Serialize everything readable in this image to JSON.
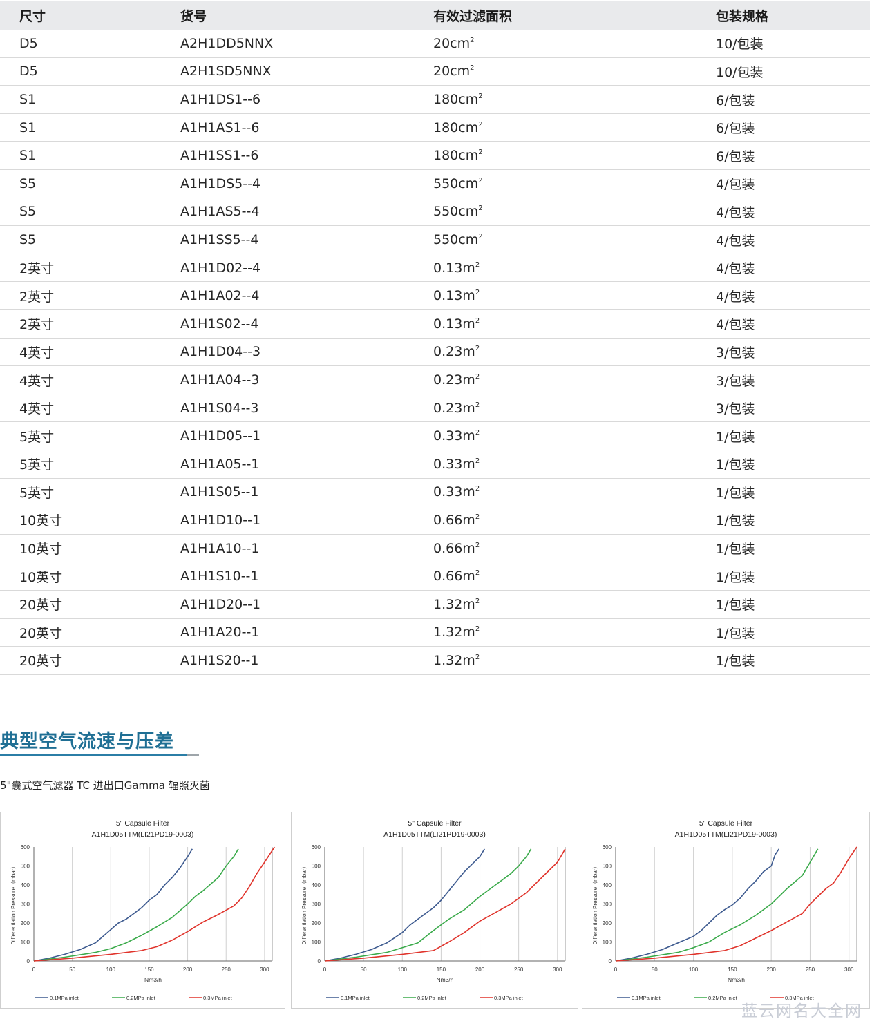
{
  "table": {
    "headers": [
      "尺寸",
      "货号",
      "有效过滤面积",
      "包装规格"
    ],
    "rows": [
      {
        "size": "D5",
        "part": "A2H1DD5NNX",
        "area": "20cm",
        "area_sup": "2",
        "pack": "10/包装"
      },
      {
        "size": "D5",
        "part": "A2H1SD5NNX",
        "area": "20cm",
        "area_sup": "2",
        "pack": "10/包装"
      },
      {
        "size": "S1",
        "part": "A1H1DS1--6",
        "area": "180cm",
        "area_sup": "2",
        "pack": "6/包装"
      },
      {
        "size": "S1",
        "part": "A1H1AS1--6",
        "area": "180cm",
        "area_sup": "2",
        "pack": "6/包装"
      },
      {
        "size": "S1",
        "part": "A1H1SS1--6",
        "area": "180cm",
        "area_sup": "2",
        "pack": "6/包装"
      },
      {
        "size": "S5",
        "part": "A1H1DS5--4",
        "area": "550cm",
        "area_sup": "2",
        "pack": "4/包装"
      },
      {
        "size": "S5",
        "part": "A1H1AS5--4",
        "area": "550cm",
        "area_sup": "2",
        "pack": "4/包装"
      },
      {
        "size": "S5",
        "part": "A1H1SS5--4",
        "area": "550cm",
        "area_sup": "2",
        "pack": "4/包装"
      },
      {
        "size": "2英寸",
        "part": "A1H1D02--4",
        "area": "0.13m",
        "area_sup": "2",
        "pack": "4/包装"
      },
      {
        "size": "2英寸",
        "part": "A1H1A02--4",
        "area": "0.13m",
        "area_sup": "2",
        "pack": "4/包装"
      },
      {
        "size": "2英寸",
        "part": "A1H1S02--4",
        "area": "0.13m",
        "area_sup": "2",
        "pack": "4/包装"
      },
      {
        "size": "4英寸",
        "part": "A1H1D04--3",
        "area": "0.23m",
        "area_sup": "2",
        "pack": "3/包装"
      },
      {
        "size": "4英寸",
        "part": "A1H1A04--3",
        "area": "0.23m",
        "area_sup": "2",
        "pack": "3/包装"
      },
      {
        "size": "4英寸",
        "part": "A1H1S04--3",
        "area": "0.23m",
        "area_sup": "2",
        "pack": "3/包装"
      },
      {
        "size": "5英寸",
        "part": "A1H1D05--1",
        "area": "0.33m",
        "area_sup": "2",
        "pack": "1/包装"
      },
      {
        "size": "5英寸",
        "part": "A1H1A05--1",
        "area": "0.33m",
        "area_sup": "2",
        "pack": "1/包装"
      },
      {
        "size": "5英寸",
        "part": "A1H1S05--1",
        "area": "0.33m",
        "area_sup": "2",
        "pack": "1/包装"
      },
      {
        "size": "10英寸",
        "part": "A1H1D10--1",
        "area": "0.66m",
        "area_sup": "2",
        "pack": "1/包装"
      },
      {
        "size": "10英寸",
        "part": "A1H1A10--1",
        "area": "0.66m",
        "area_sup": "2",
        "pack": "1/包装"
      },
      {
        "size": "10英寸",
        "part": "A1H1S10--1",
        "area": "0.66m",
        "area_sup": "2",
        "pack": "1/包装"
      },
      {
        "size": "20英寸",
        "part": "A1H1D20--1",
        "area": "1.32m",
        "area_sup": "2",
        "pack": "1/包装"
      },
      {
        "size": "20英寸",
        "part": "A1H1A20--1",
        "area": "1.32m",
        "area_sup": "2",
        "pack": "1/包装"
      },
      {
        "size": "20英寸",
        "part": "A1H1S20--1",
        "area": "1.32m",
        "area_sup": "2",
        "pack": "1/包装"
      }
    ]
  },
  "section": {
    "title": "典型空气流速与压差",
    "subtitle": "5\"囊式空气滤器 TC 进出口Gamma 辐照灭菌"
  },
  "watermark": "蓝云网名大全网",
  "chart_data": [
    {
      "type": "line",
      "title": "5\" Capsule Filter",
      "subtitle": "A1H1D05TTM(LI21PD19-0003)",
      "xlabel": "Nm3/h",
      "ylabel": "Differentiation Pressure（mbar）",
      "xlim": [
        0,
        310
      ],
      "ylim": [
        0,
        600
      ],
      "xticks": [
        0,
        50,
        100,
        150,
        200,
        250,
        300
      ],
      "yticks": [
        0,
        100,
        200,
        300,
        400,
        500,
        600
      ],
      "grid": true,
      "legend": "bottom",
      "series": [
        {
          "name": "0.1MPa inlet",
          "color": "#3d5a8f",
          "x": [
            0,
            20,
            40,
            60,
            80,
            90,
            100,
            110,
            120,
            130,
            140,
            150,
            160,
            170,
            180,
            190,
            200,
            206
          ],
          "y": [
            0,
            15,
            35,
            60,
            95,
            130,
            165,
            200,
            220,
            250,
            280,
            320,
            350,
            400,
            440,
            490,
            550,
            590
          ]
        },
        {
          "name": "0.2MPa inlet",
          "color": "#3aaa4a",
          "x": [
            0,
            40,
            80,
            100,
            120,
            140,
            160,
            180,
            200,
            210,
            220,
            240,
            250,
            260,
            266
          ],
          "y": [
            0,
            20,
            45,
            65,
            95,
            135,
            180,
            230,
            300,
            340,
            370,
            440,
            500,
            550,
            590
          ]
        },
        {
          "name": "0.3MPa inlet",
          "color": "#e0332b",
          "x": [
            0,
            50,
            100,
            140,
            160,
            180,
            200,
            220,
            240,
            260,
            270,
            280,
            290,
            300,
            313
          ],
          "y": [
            0,
            15,
            35,
            55,
            75,
            110,
            155,
            205,
            245,
            290,
            330,
            390,
            460,
            520,
            600
          ]
        }
      ]
    },
    {
      "type": "line",
      "title": "5\" Capsule Filter",
      "subtitle": "A1H1D05TTM(LI21PD19-0003)",
      "xlabel": "Nm3/h",
      "ylabel": "Differentiation Pressure（mbar）",
      "xlim": [
        0,
        310
      ],
      "ylim": [
        0,
        600
      ],
      "xticks": [
        0,
        50,
        100,
        150,
        200,
        250,
        300
      ],
      "yticks": [
        0,
        100,
        200,
        300,
        400,
        500,
        600
      ],
      "grid": true,
      "legend": "bottom",
      "series": [
        {
          "name": "0.1MPa inlet",
          "color": "#3d5a8f",
          "x": [
            0,
            20,
            40,
            60,
            80,
            100,
            110,
            120,
            140,
            150,
            160,
            170,
            180,
            190,
            200,
            206
          ],
          "y": [
            0,
            15,
            35,
            60,
            95,
            150,
            190,
            220,
            280,
            320,
            370,
            420,
            470,
            510,
            550,
            590
          ]
        },
        {
          "name": "0.2MPa inlet",
          "color": "#3aaa4a",
          "x": [
            0,
            40,
            80,
            120,
            140,
            160,
            180,
            200,
            220,
            240,
            250,
            260,
            266
          ],
          "y": [
            0,
            20,
            45,
            95,
            160,
            220,
            270,
            340,
            400,
            460,
            500,
            550,
            590
          ]
        },
        {
          "name": "0.3MPa inlet",
          "color": "#e0332b",
          "x": [
            0,
            50,
            100,
            140,
            160,
            180,
            200,
            220,
            240,
            260,
            280,
            300,
            310
          ],
          "y": [
            0,
            15,
            35,
            55,
            100,
            150,
            210,
            255,
            300,
            360,
            440,
            520,
            590
          ]
        }
      ]
    },
    {
      "type": "line",
      "title": "5\" Capsule Filter",
      "subtitle": "A1H1D05TTM(LI21PD19-0003)",
      "xlabel": "Nm3/h",
      "ylabel": "Differentiation Pressure（mbar）",
      "xlim": [
        0,
        310
      ],
      "ylim": [
        0,
        600
      ],
      "xticks": [
        0,
        50,
        100,
        150,
        200,
        250,
        300
      ],
      "yticks": [
        0,
        100,
        200,
        300,
        400,
        500,
        600
      ],
      "grid": true,
      "legend": "bottom",
      "series": [
        {
          "name": "0.1MPa inlet",
          "color": "#3d5a8f",
          "x": [
            0,
            20,
            40,
            60,
            80,
            100,
            110,
            120,
            130,
            140,
            150,
            160,
            170,
            180,
            190,
            200,
            205,
            210
          ],
          "y": [
            0,
            15,
            35,
            60,
            95,
            130,
            160,
            200,
            240,
            270,
            295,
            330,
            380,
            420,
            470,
            500,
            560,
            590
          ]
        },
        {
          "name": "0.2MPa inlet",
          "color": "#3aaa4a",
          "x": [
            0,
            40,
            80,
            100,
            120,
            140,
            160,
            180,
            200,
            220,
            240,
            250,
            260
          ],
          "y": [
            0,
            20,
            45,
            70,
            100,
            150,
            190,
            240,
            300,
            380,
            450,
            520,
            590
          ]
        },
        {
          "name": "0.3MPa inlet",
          "color": "#e0332b",
          "x": [
            0,
            50,
            100,
            140,
            160,
            180,
            200,
            220,
            240,
            250,
            260,
            270,
            280,
            290,
            300,
            310
          ],
          "y": [
            0,
            15,
            35,
            55,
            80,
            120,
            160,
            205,
            250,
            300,
            340,
            380,
            410,
            470,
            540,
            600
          ]
        }
      ]
    }
  ]
}
